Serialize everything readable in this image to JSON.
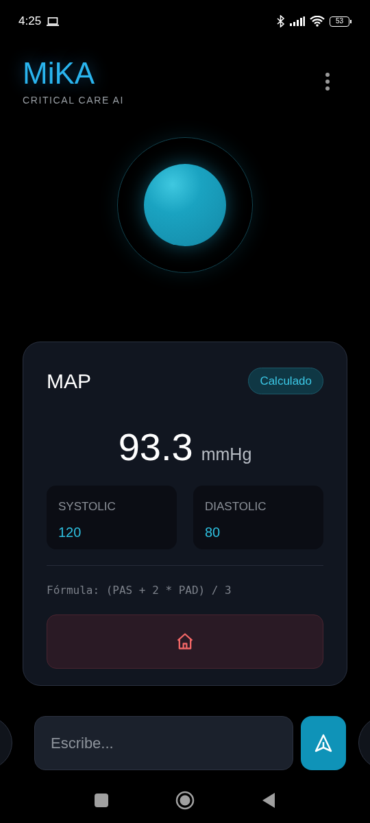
{
  "status_bar": {
    "time": "4:25",
    "battery": "53"
  },
  "header": {
    "title": "MiKA",
    "subtitle": "CRITICAL CARE AI"
  },
  "result_card": {
    "title": "MAP",
    "badge": "Calculado",
    "value": "93.3",
    "unit": "mmHg",
    "readings": [
      {
        "label": "SYSTOLIC",
        "value": "120"
      },
      {
        "label": "DIASTOLIC",
        "value": "80"
      }
    ],
    "formula": "Fórmula: (PAS + 2 * PAD) / 3"
  },
  "composer": {
    "placeholder": "Escribe..."
  }
}
